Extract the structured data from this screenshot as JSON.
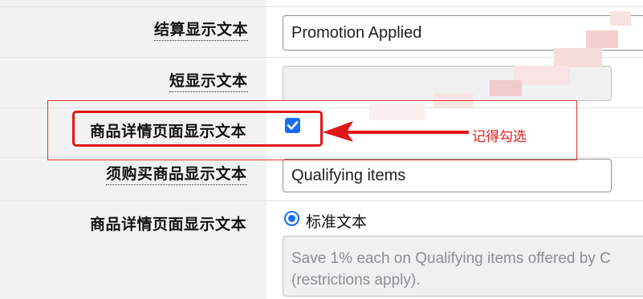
{
  "rows": [
    {
      "label": "结算显示文本",
      "value": "Promotion Applied"
    },
    {
      "label": "短显示文本",
      "value": ""
    },
    {
      "label": "商品详情页面显示文本",
      "checked": true
    },
    {
      "label": "须购买商品显示文本",
      "value": "Qualifying items"
    },
    {
      "label": "商品详情页面显示文本",
      "radio_label": "标准文本",
      "radio_selected": true,
      "textarea": "Save 1% each on Qualifying items offered by C\n(restrictions apply)."
    }
  ],
  "annotation": {
    "text": "记得勾选",
    "color": "#e02020"
  },
  "colors": {
    "accent": "#1a6ef0",
    "label_bg": "#f2f2f2"
  }
}
